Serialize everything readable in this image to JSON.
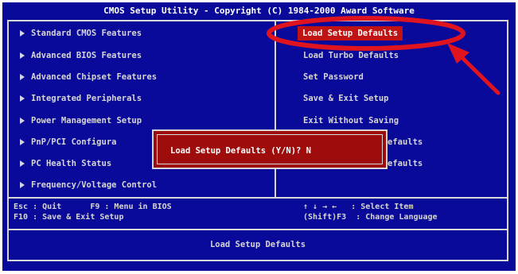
{
  "title": "CMOS Setup Utility - Copyright (C) 1984-2000 Award Software",
  "left_menu": [
    "Standard CMOS Features",
    "Advanced BIOS Features",
    "Advanced Chipset Features",
    "Integrated Peripherals",
    "Power Management Setup",
    "PnP/PCI Configura",
    "PC Health Status",
    "Frequency/Voltage Control"
  ],
  "right_menu": [
    "Load Setup Defaults",
    "Load Turbo Defaults",
    "Set Password",
    "Save & Exit Setup",
    "Exit Without Saving",
    "efaults",
    "efaults"
  ],
  "help": {
    "left_line1": "Esc : Quit      F9 : Menu in BIOS",
    "left_line2": "F10 : Save & Exit Setup",
    "right_line1": "↑ ↓ → ←   : Select Item",
    "right_line2": "(Shift)F3  : Change Language"
  },
  "status": "Load Setup Defaults",
  "dialog": {
    "prompt": "Load Setup Defaults (Y/N)? N"
  },
  "colors": {
    "background": "#0a0a9a",
    "highlight": "#c01414",
    "annotation": "#e0141e"
  },
  "annotation": {
    "shapes": [
      "ellipse",
      "arrow"
    ]
  }
}
